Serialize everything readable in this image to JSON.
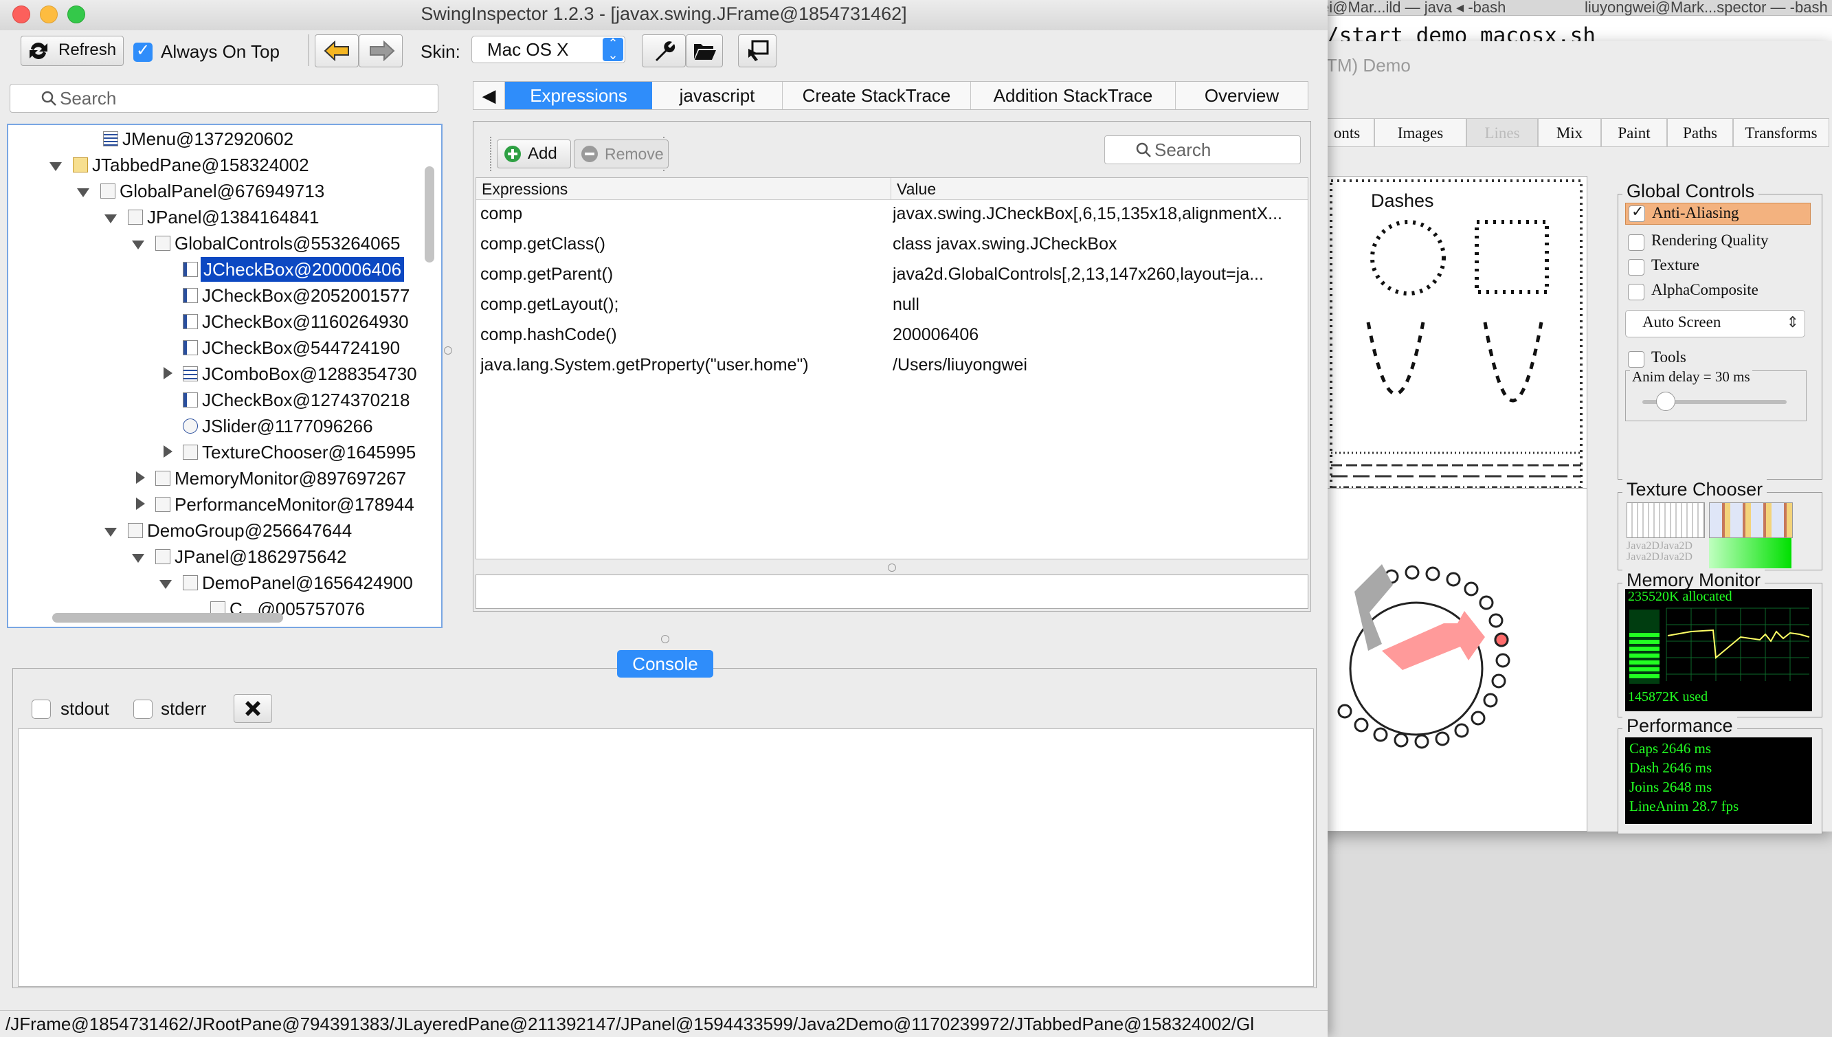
{
  "background": {
    "terminal_tabs": [
      "ei@Mar...ild — java ◂ -bash",
      "liuyongwei@Mark...spector — -bash"
    ],
    "terminal_line": "/start_demo_macosx.sh",
    "demo_title": "TM) Demo",
    "demo_tabs": [
      "onts",
      "Images",
      "Lines",
      "Mix",
      "Paint",
      "Paths",
      "Transforms"
    ],
    "dashes_label": "Dashes",
    "global_controls": {
      "title": "Global Controls",
      "items": [
        {
          "label": "Anti-Aliasing",
          "checked": true
        },
        {
          "label": "Rendering Quality",
          "checked": false
        },
        {
          "label": "Texture",
          "checked": false
        },
        {
          "label": "AlphaComposite",
          "checked": false
        }
      ],
      "select_value": "Auto Screen",
      "tools_label": "Tools",
      "anim_delay": "Anim delay = 30 ms"
    },
    "texture_chooser": {
      "title": "Texture Chooser",
      "texture_text": "Java2DJava2D"
    },
    "memory_monitor": {
      "title": "Memory Monitor",
      "allocated": "235520K allocated",
      "used": "145872K used"
    },
    "performance": {
      "title": "Performance",
      "lines": [
        "Caps 2646 ms",
        "Dash 2646 ms",
        "Joins 2648 ms",
        "LineAnim 28.7 fps"
      ]
    }
  },
  "window": {
    "title": "SwingInspector 1.2.3 - [javax.swing.JFrame@1854731462]"
  },
  "toolbar": {
    "refresh_label": "Refresh",
    "always_on_top_label": "Always On Top",
    "always_on_top_checked": true,
    "skin_label": "Skin:",
    "skin_value": "Mac OS X"
  },
  "tree": {
    "search_placeholder": "Search",
    "nodes": [
      "JMenu@1372920602",
      "JTabbedPane@158324002",
      "GlobalPanel@676949713",
      "JPanel@1384164841",
      "GlobalControls@553264065",
      "JCheckBox@200006406",
      "JCheckBox@2052001577",
      "JCheckBox@1160264930",
      "JCheckBox@544724190",
      "JComboBox@1288354730",
      "JCheckBox@1274370218",
      "JSlider@1177096266",
      "TextureChooser@1645995",
      "MemoryMonitor@897697267",
      "PerformanceMonitor@178944",
      "DemoGroup@256647644",
      "JPanel@1862975642",
      "DemoPanel@1656424900",
      "C...@005757076"
    ]
  },
  "inspector_tabs": [
    "Expressions",
    "javascript",
    "Create StackTrace",
    "Addition StackTrace",
    "Overview"
  ],
  "expressions": {
    "add_label": "Add",
    "remove_label": "Remove",
    "search_placeholder": "Search",
    "headers": [
      "Expressions",
      "Value"
    ],
    "rows": [
      {
        "expr": "comp",
        "value": "javax.swing.JCheckBox[,6,15,135x18,alignmentX..."
      },
      {
        "expr": "comp.getClass()",
        "value": "class javax.swing.JCheckBox"
      },
      {
        "expr": "comp.getParent()",
        "value": "java2d.GlobalControls[,2,13,147x260,layout=ja..."
      },
      {
        "expr": "comp.getLayout();",
        "value": "null"
      },
      {
        "expr": "comp.hashCode()",
        "value": "200006406"
      },
      {
        "expr": "java.lang.System.getProperty(\"user.home\")",
        "value": "/Users/liuyongwei"
      }
    ]
  },
  "console": {
    "button_label": "Console",
    "stdout_label": "stdout",
    "stderr_label": "stderr"
  },
  "status": {
    "path": "/JFrame@1854731462/JRootPane@794391383/JLayeredPane@211392147/JPanel@1594433599/Java2Demo@1170239972/JTabbedPane@158324002/Gl"
  },
  "colors": {
    "selection": "#0c48c2",
    "accent": "#2f8dfa",
    "monitor_green": "#22ff22"
  }
}
